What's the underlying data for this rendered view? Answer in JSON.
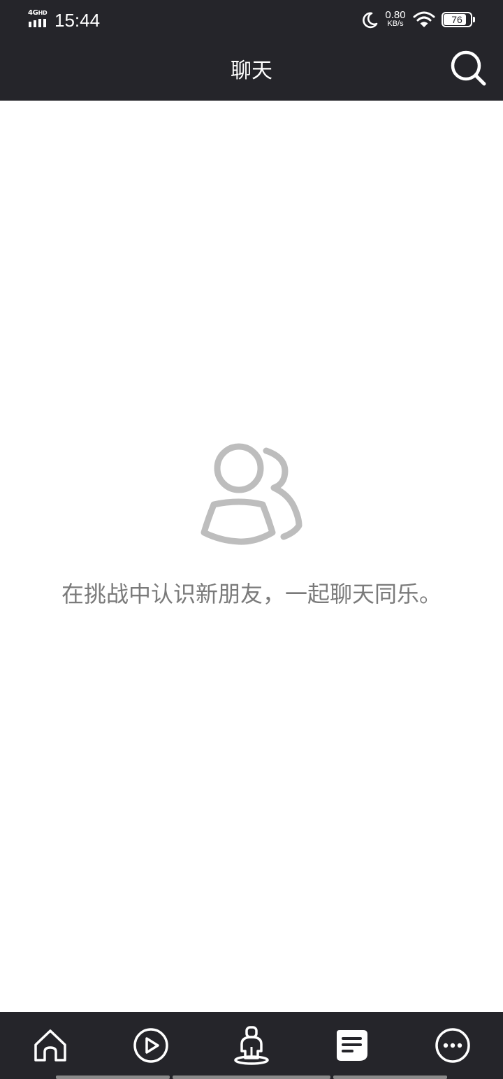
{
  "status_bar": {
    "network_type": "4G",
    "network_hd": "HD",
    "time": "15:44",
    "net_speed_value": "0.80",
    "net_speed_unit": "KB/s",
    "battery_level": "76",
    "icons": [
      "signal-icon",
      "moon-icon",
      "wifi-icon",
      "battery-icon"
    ]
  },
  "header": {
    "title": "聊天",
    "search_icon": "search-icon"
  },
  "empty_state": {
    "icon": "people-icon",
    "message": "在挑战中认识新朋友，一起聊天同乐。"
  },
  "tab_bar": {
    "active_tab": "chat",
    "tabs": [
      {
        "id": "home",
        "icon": "home-icon"
      },
      {
        "id": "video",
        "icon": "play-icon"
      },
      {
        "id": "challenge",
        "icon": "challenge-icon"
      },
      {
        "id": "chat",
        "icon": "chat-icon"
      },
      {
        "id": "more",
        "icon": "more-icon"
      }
    ]
  },
  "colors": {
    "bar_background": "#25252a",
    "icon_white": "#ffffff",
    "empty_icon": "#bdbdbd",
    "empty_text": "#7a7a7a",
    "gesture_bar": "#8a8a8a"
  }
}
